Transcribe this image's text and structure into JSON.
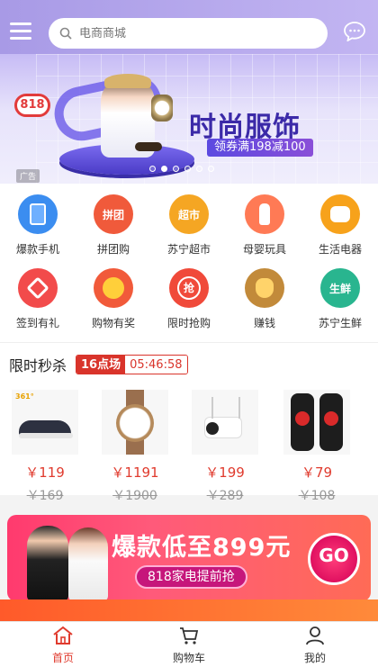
{
  "header": {
    "search_placeholder": "电商商城",
    "icons": {
      "menu": "hamburger-menu-icon",
      "search": "search-icon",
      "message": "chat-bubble-icon"
    }
  },
  "banner": {
    "badge": "818",
    "title": "时尚服饰",
    "coupon": "领券满198减100",
    "ad_label": "广告",
    "slides_total": 6,
    "active_slide": 2
  },
  "categories": [
    {
      "label": "爆款手机",
      "icon": "phone-icon",
      "color": "#3b8df0"
    },
    {
      "label": "拼团购",
      "icon": "group-buy-icon",
      "color": "#f05a3b",
      "glyph": "拼团"
    },
    {
      "label": "苏宁超市",
      "icon": "supermarket-icon",
      "color": "#f5a623",
      "glyph": "超市"
    },
    {
      "label": "母婴玩具",
      "icon": "baby-bottle-icon",
      "color": "#ff7a55"
    },
    {
      "label": "生活电器",
      "icon": "rice-cooker-icon",
      "color": "#f7a21b"
    },
    {
      "label": "签到有礼",
      "icon": "gift-tag-icon",
      "color": "#f24b4b"
    },
    {
      "label": "购物有奖",
      "icon": "prize-wheel-icon",
      "color": "#f15a3a"
    },
    {
      "label": "限时抢购",
      "icon": "flash-sale-icon",
      "color": "#f04a3a",
      "glyph": "抢"
    },
    {
      "label": "赚钱",
      "icon": "money-bag-icon",
      "color": "#c28a3a"
    },
    {
      "label": "苏宁生鲜",
      "icon": "fresh-food-icon",
      "color": "#29b58f",
      "glyph": "生鲜"
    }
  ],
  "flash_sale": {
    "title": "限时秒杀",
    "session": "16点场",
    "countdown": "05:46:58",
    "items": [
      {
        "name": "shoe",
        "price": "￥119",
        "old_price": "￥169"
      },
      {
        "name": "watch",
        "price": "￥1191",
        "old_price": "￥1900"
      },
      {
        "name": "camera",
        "price": "￥199",
        "old_price": "￥289"
      },
      {
        "name": "knee-pad",
        "price": "￥79",
        "old_price": "￥108"
      }
    ]
  },
  "promo": {
    "title": "爆款低至899元",
    "subtitle": "818家电提前抢",
    "go_label": "GO"
  },
  "tabbar": [
    {
      "label": "首页",
      "icon": "home-icon",
      "active": true
    },
    {
      "label": "购物车",
      "icon": "cart-icon",
      "active": false
    },
    {
      "label": "我的",
      "icon": "user-icon",
      "active": false
    }
  ],
  "colors": {
    "accent": "#e03b2e",
    "header": "#b3a5ee"
  }
}
